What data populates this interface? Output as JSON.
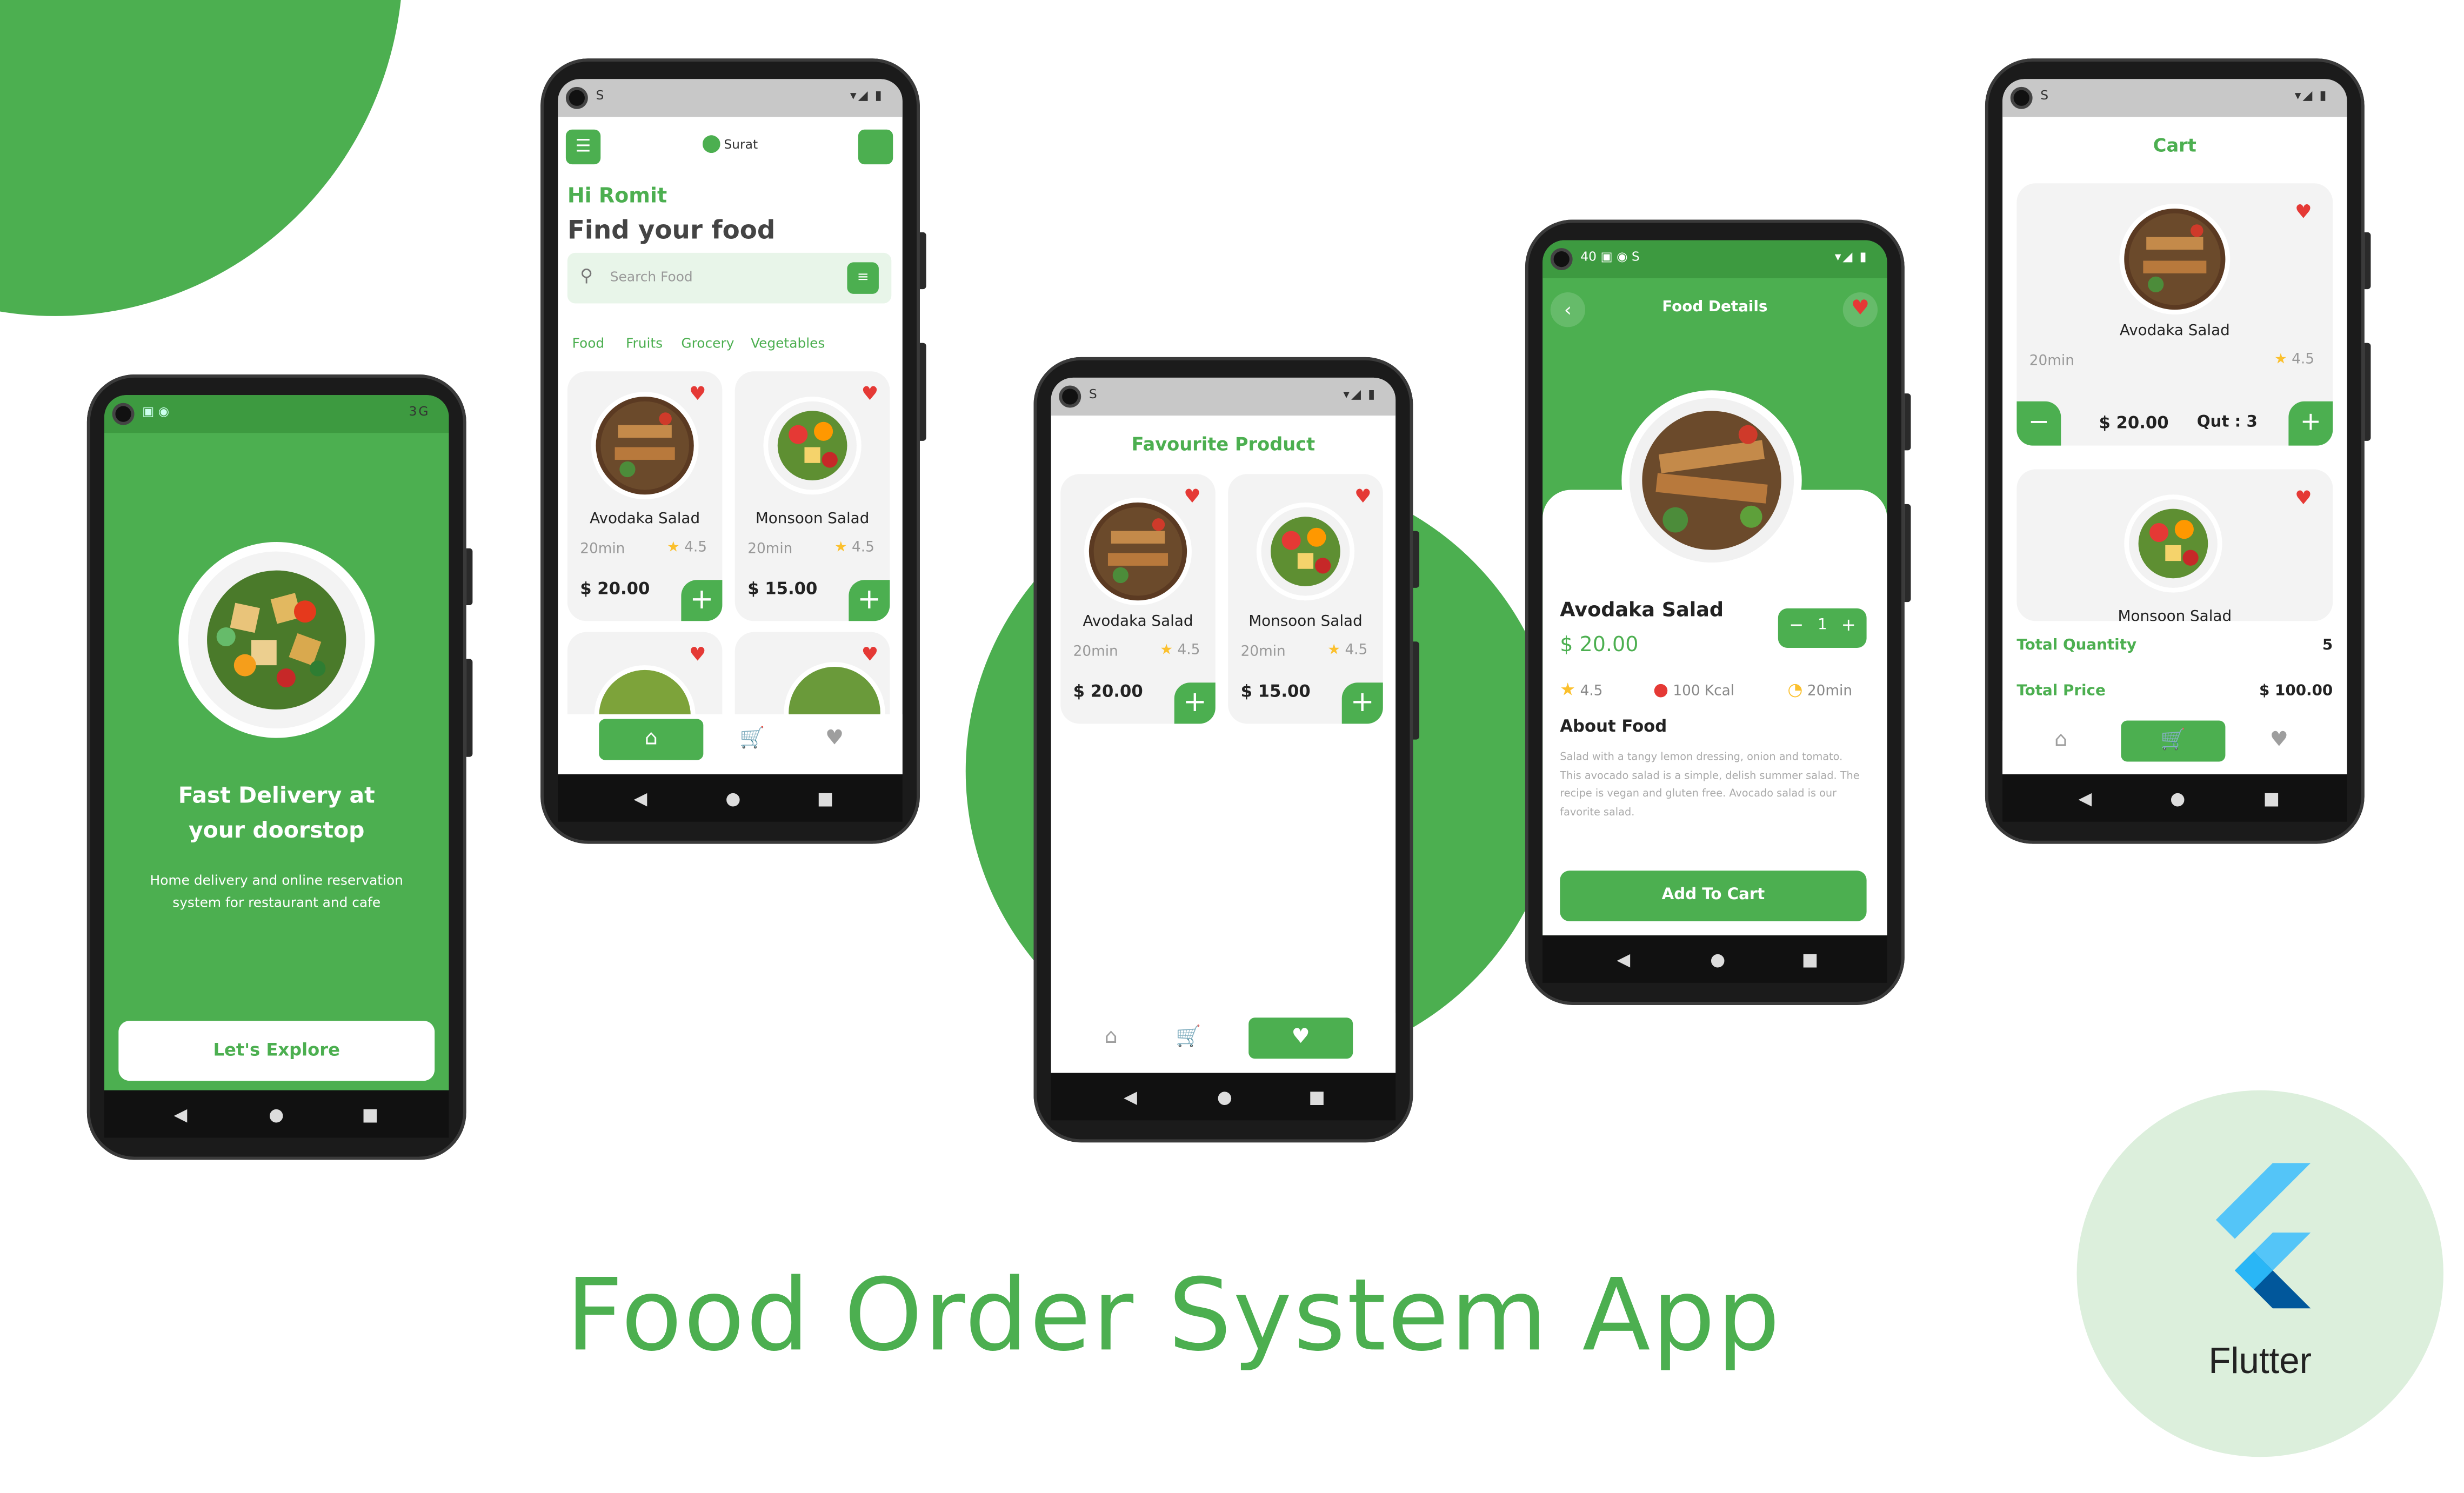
{
  "title": "Food Order System App",
  "flutter_label": "Flutter",
  "colors": {
    "primary": "#4caf50",
    "heart": "#e53935",
    "star": "#fbc02d"
  },
  "splash": {
    "heading_line1": "Fast Delivery at",
    "heading_line2": "your doorstop",
    "sub_line1": "Home delivery and online reservation",
    "sub_line2": "system for restaurant and cafe",
    "button": "Let's Explore",
    "status_right": "3G"
  },
  "home": {
    "location": "Surat",
    "greeting": "Hi Romit",
    "headline": "Find your food",
    "search_placeholder": "Search Food",
    "categories": [
      "Food",
      "Fruits",
      "Grocery",
      "Vegetables"
    ],
    "items": [
      {
        "name": "Avodaka Salad",
        "time": "20min",
        "rating": "4.5",
        "price": "$ 20.00"
      },
      {
        "name": "Monsoon Salad",
        "time": "20min",
        "rating": "4.5",
        "price": "$ 15.00"
      }
    ]
  },
  "favourite": {
    "title": "Favourite Product",
    "items": [
      {
        "name": "Avodaka Salad",
        "time": "20min",
        "rating": "4.5",
        "price": "$ 20.00"
      },
      {
        "name": "Monsoon Salad",
        "time": "20min",
        "rating": "4.5",
        "price": "$ 15.00"
      }
    ]
  },
  "details": {
    "title": "Food Details",
    "name": "Avodaka Salad",
    "price": "$ 20.00",
    "qty": "1",
    "rating": "4.5",
    "kcal": "100 Kcal",
    "time": "20min",
    "about_title": "About Food",
    "about_text": "Salad with a tangy lemon dressing, onion and tomato. This avocado salad is a simple, delish summer salad. The recipe is vegan and gluten free. Avocado salad is our favorite salad.",
    "button": "Add To Cart",
    "status_left": "40"
  },
  "cart": {
    "title": "Cart",
    "item1": {
      "name": "Avodaka Salad",
      "time": "20min",
      "rating": "4.5",
      "price": "$ 20.00",
      "qty": "Qut : 3"
    },
    "item2": {
      "name": "Monsoon Salad"
    },
    "total_quantity_label": "Total Quantity",
    "total_quantity": "5",
    "total_price_label": "Total Price",
    "total_price": "$ 100.00"
  }
}
